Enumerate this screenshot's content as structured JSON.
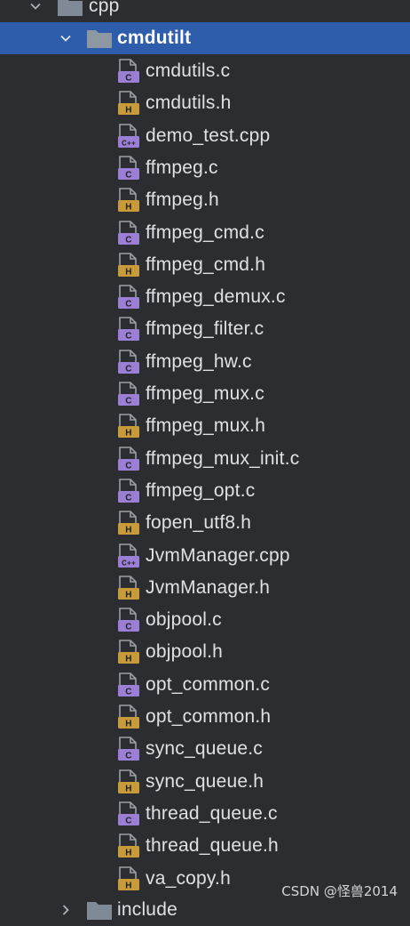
{
  "tree": {
    "parent": {
      "label": "cpp"
    },
    "folder": {
      "label": "cmdutilt"
    },
    "files": [
      {
        "label": "cmdutils.c",
        "type": "c"
      },
      {
        "label": "cmdutils.h",
        "type": "h"
      },
      {
        "label": "demo_test.cpp",
        "type": "cpp"
      },
      {
        "label": "ffmpeg.c",
        "type": "c"
      },
      {
        "label": "ffmpeg.h",
        "type": "h"
      },
      {
        "label": "ffmpeg_cmd.c",
        "type": "c"
      },
      {
        "label": "ffmpeg_cmd.h",
        "type": "h"
      },
      {
        "label": "ffmpeg_demux.c",
        "type": "c"
      },
      {
        "label": "ffmpeg_filter.c",
        "type": "c"
      },
      {
        "label": "ffmpeg_hw.c",
        "type": "c"
      },
      {
        "label": "ffmpeg_mux.c",
        "type": "c"
      },
      {
        "label": "ffmpeg_mux.h",
        "type": "h"
      },
      {
        "label": "ffmpeg_mux_init.c",
        "type": "c"
      },
      {
        "label": "ffmpeg_opt.c",
        "type": "c"
      },
      {
        "label": "fopen_utf8.h",
        "type": "h"
      },
      {
        "label": "JvmManager.cpp",
        "type": "cpp"
      },
      {
        "label": "JvmManager.h",
        "type": "h"
      },
      {
        "label": "objpool.c",
        "type": "c"
      },
      {
        "label": "objpool.h",
        "type": "h"
      },
      {
        "label": "opt_common.c",
        "type": "c"
      },
      {
        "label": "opt_common.h",
        "type": "h"
      },
      {
        "label": "sync_queue.c",
        "type": "c"
      },
      {
        "label": "sync_queue.h",
        "type": "h"
      },
      {
        "label": "thread_queue.c",
        "type": "c"
      },
      {
        "label": "thread_queue.h",
        "type": "h"
      },
      {
        "label": "va_copy.h",
        "type": "h"
      }
    ],
    "next_folder": {
      "label": "include"
    }
  },
  "icon_badges": {
    "c": "C",
    "h": "H",
    "cpp": "C++"
  },
  "colors": {
    "c_badge": "#9a7fd4",
    "h_badge": "#c79a3a",
    "cpp_badge": "#9a7fd4",
    "folder": "#7f8a96",
    "selection": "#2e5dab",
    "background": "#2b2d30"
  },
  "watermark": {
    "text": "CSDN @怪兽2014"
  }
}
